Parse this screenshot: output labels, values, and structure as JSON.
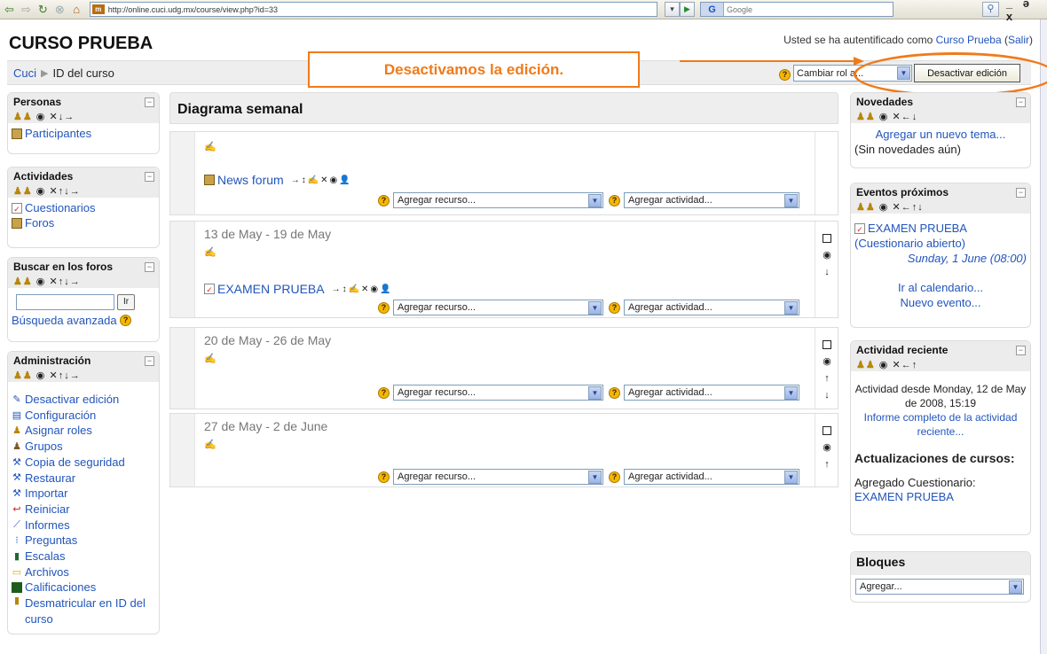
{
  "browser": {
    "url": "http://online.cuci.udg.mx/course/view.php?id=33",
    "favicon": "m",
    "google_label": "G",
    "google_placeholder": "Google",
    "window_controls": "_ ə x"
  },
  "header": {
    "site_title": "CURSO PRUEBA",
    "login_prefix": "Usted se ha autentificado como",
    "login_user": "Curso Prueba",
    "logout": "Salir"
  },
  "breadcrumb": {
    "home": "Cuci",
    "current": "ID del curso"
  },
  "annotation": {
    "text": "Desactivamos la edición."
  },
  "role_select": {
    "value": "Cambiar rol a..."
  },
  "edit_button": {
    "label": "Desactivar edición"
  },
  "left_blocks": {
    "personas": {
      "title": "Personas",
      "items": [
        "Participantes"
      ]
    },
    "actividades": {
      "title": "Actividades",
      "items": [
        "Cuestionarios",
        "Foros"
      ]
    },
    "buscar": {
      "title": "Buscar en los foros",
      "button": "Ir",
      "advanced": "Búsqueda avanzada"
    },
    "admin": {
      "title": "Administración",
      "items": [
        "Desactivar edición",
        "Configuración",
        "Asignar roles",
        "Grupos",
        "Copia de seguridad",
        "Restaurar",
        "Importar",
        "Reiniciar",
        "Informes",
        "Preguntas",
        "Escalas",
        "Archivos",
        "Calificaciones",
        "Desmatricular en ID del curso"
      ]
    }
  },
  "main": {
    "title": "Diagrama semanal",
    "topic0": {
      "resource": "News forum"
    },
    "weeks": [
      {
        "label": "13 de May - 19 de May",
        "resource": "EXAMEN PRUEBA"
      },
      {
        "label": "20 de May - 26 de May"
      },
      {
        "label": "27 de May - 2 de June"
      }
    ],
    "add_resource": "Agregar recurso...",
    "add_activity": "Agregar actividad..."
  },
  "right_blocks": {
    "novedades": {
      "title": "Novedades",
      "add_topic": "Agregar un nuevo tema...",
      "empty": "(Sin novedades aún)"
    },
    "eventos": {
      "title": "Eventos próximos",
      "event_name": "EXAMEN PRUEBA",
      "event_type": "(Cuestionario abierto)",
      "event_date": "Sunday, 1 June",
      "event_time": "(08:00)",
      "go_calendar": "Ir al calendario...",
      "new_event": "Nuevo evento..."
    },
    "actividad": {
      "title": "Actividad reciente",
      "since": "Actividad desde Monday, 12 de May de 2008, 15:19",
      "full_report": "Informe completo de la actividad reciente...",
      "updates_title": "Actualizaciones de cursos:",
      "added_label": "Agregado Cuestionario:",
      "added_item": "EXAMEN PRUEBA"
    },
    "bloques": {
      "title": "Bloques",
      "select": "Agregar..."
    }
  },
  "colors": {
    "accent": "#f07a1a",
    "link": "#2255bb"
  }
}
